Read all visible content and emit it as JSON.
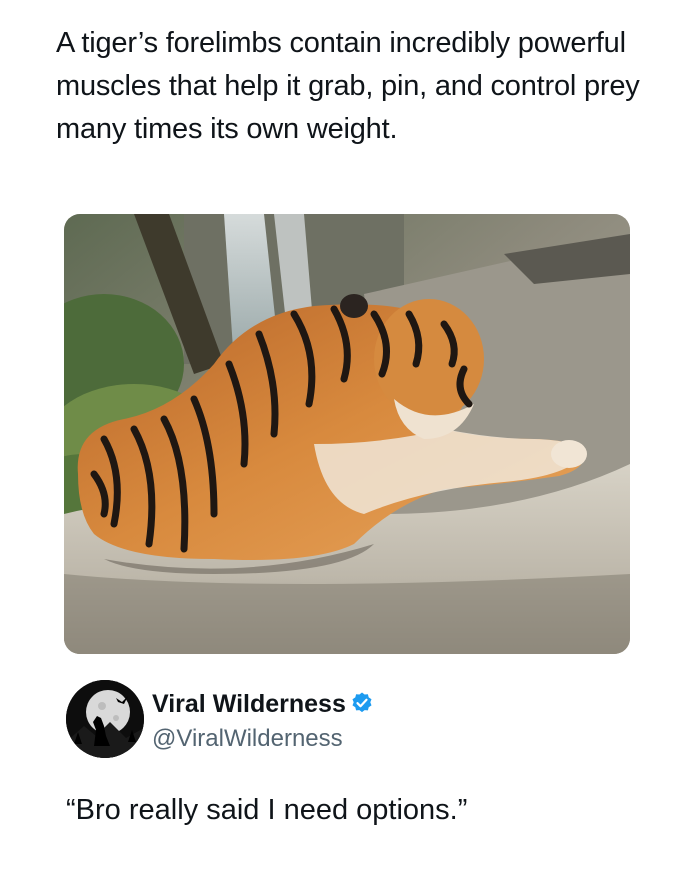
{
  "headline": "A tiger’s forelimbs contain incredibly powerful muscles that help it grab, pin, and control prey many times its own weight.",
  "photo": {
    "subject": "tiger-lying-on-rock"
  },
  "author": {
    "name": "Viral Wilderness",
    "handle": "@ViralWilderness",
    "verified_icon": "verified-badge-icon",
    "verified_color": "#1d9bf0",
    "avatar_icon": "howling-wolf-moon-avatar"
  },
  "tweet": {
    "text": "“Bro really said I need options.”"
  },
  "colors": {
    "text": "#0f1419",
    "secondary_text": "#536471",
    "background": "#ffffff"
  }
}
